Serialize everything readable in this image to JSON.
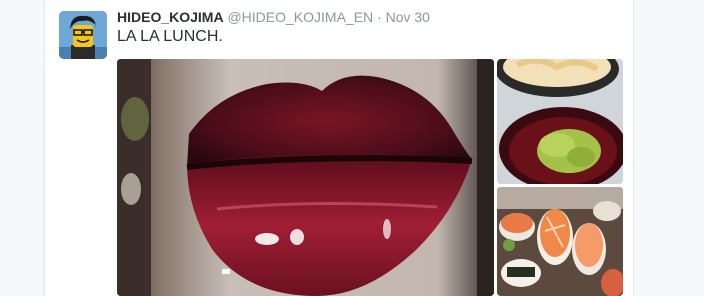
{
  "tweet": {
    "author_name": "HIDEO_KOJIMA",
    "handle": "@HIDEO_KOJIMA_EN",
    "separator": "·",
    "timestamp": "Nov 30",
    "text": "LA LA LUNCH."
  },
  "colors": {
    "page_bg": "#f5f8fa",
    "name": "#292f33",
    "meta": "#8899a6"
  },
  "media": {
    "photos": [
      {
        "subject": "lips-photo"
      },
      {
        "subject": "ginger-and-wasabi-bowls-photo"
      },
      {
        "subject": "sushi-platter-photo"
      }
    ]
  }
}
